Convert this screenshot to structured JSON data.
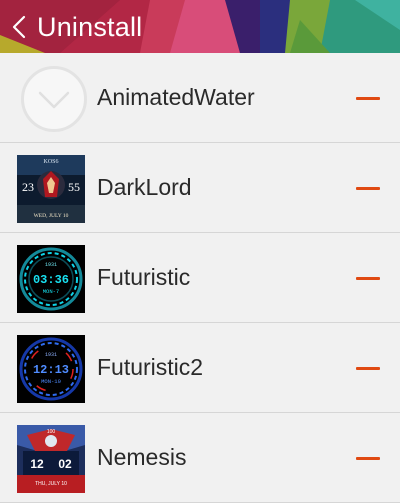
{
  "header": {
    "title": "Uninstall",
    "back_icon": "chevron-left-icon"
  },
  "colors": {
    "remove_accent": "#e04a12",
    "background": "#f1f1f1"
  },
  "faces": [
    {
      "name": "AnimatedWater"
    },
    {
      "name": "DarkLord",
      "thumb_text": {
        "top": "KOS6",
        "left": "23",
        "right": "55",
        "bottom": "WED, JULY 10"
      }
    },
    {
      "name": "Futuristic",
      "thumb_text": {
        "top": "1931",
        "time": "03:36",
        "date": "MON-7"
      }
    },
    {
      "name": "Futuristic2",
      "thumb_text": {
        "top": "1931",
        "time": "12:13",
        "date": "MON-10"
      }
    },
    {
      "name": "Nemesis",
      "thumb_text": {
        "top": "100",
        "left": "12",
        "right": "02",
        "bottom": "THU, JULY 10"
      }
    }
  ]
}
